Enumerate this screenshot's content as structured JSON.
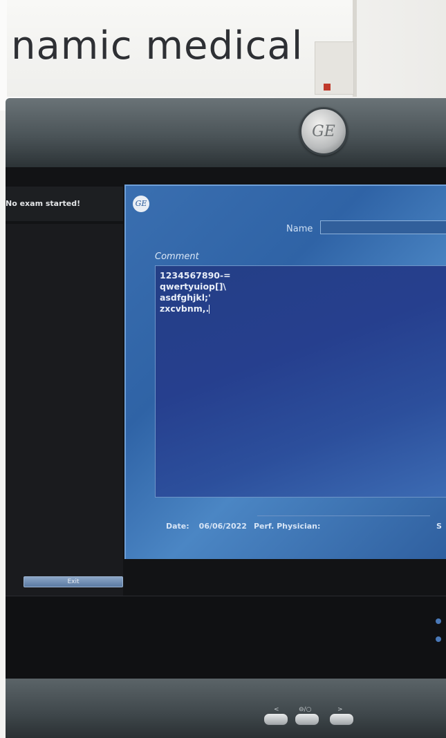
{
  "sign": {
    "text": "namic medical"
  },
  "monitor": {
    "badge_text": "GE"
  },
  "screen": {
    "status": "No exam started!",
    "exit_label": "Exit"
  },
  "dialog": {
    "logo_text": "GE",
    "name_label": "Name",
    "name_value": "",
    "comment_label": "Comment",
    "comment_lines": [
      "1234567890-=",
      "qwertyuiop[]\\",
      "asdfghjkl;'",
      "zxcvbnm,."
    ],
    "date_label": "Date:",
    "date_value": "06/06/2022",
    "physician_label": "Perf. Physician:",
    "physician_value": "",
    "right_cut_text": "S"
  },
  "hardware_buttons": {
    "left_symbol": "<",
    "center_symbol": "⊖/○",
    "right_symbol": ">"
  },
  "colors": {
    "dialog_blue": "#3a6fb0",
    "comment_blue": "#263f8e",
    "screen_black": "#121315"
  }
}
